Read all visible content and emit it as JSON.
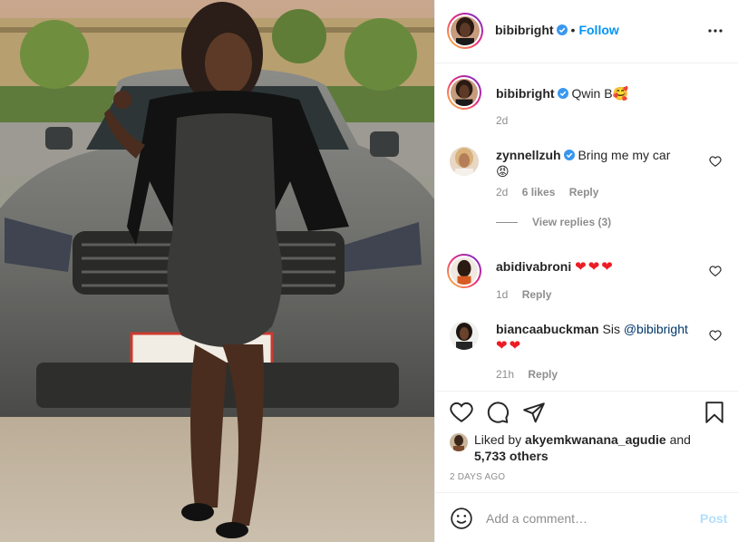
{
  "post": {
    "photo_alt": "image-photo",
    "author": "bibibright",
    "follow_label": "Follow",
    "caption": {
      "username": "bibibright",
      "text": "Qwin B",
      "emoji": "🥰",
      "time": "2d"
    }
  },
  "comments": [
    {
      "username": "zynnellzuh",
      "verified": true,
      "text": "Bring me my car",
      "emoji": "😡",
      "time": "2d",
      "likes": "6 likes",
      "reply_label": "Reply",
      "view_replies": "View replies (3)"
    },
    {
      "username": "abidivabroni",
      "verified": false,
      "hearts": "❤❤❤",
      "time": "1d",
      "reply_label": "Reply"
    },
    {
      "username": "biancaabuckman",
      "verified": false,
      "text": "Sis ",
      "mention": "@bibibright",
      "hearts": "❤❤",
      "time": "21h",
      "reply_label": "Reply"
    }
  ],
  "actions": {
    "liked_by_prefix": "Liked by ",
    "liked_by_user": "akyemkwanana_agudie",
    "liked_and": " and",
    "others": "5,733 others",
    "timeago": "2 DAYS AGO"
  },
  "composer": {
    "placeholder": "Add a comment…",
    "post_label": "Post"
  },
  "colors": {
    "accent": "#0095f6",
    "link": "#00376b",
    "muted": "#8e8e8e",
    "post_disabled": "#b2dffc",
    "heart_red": "#ed1c24"
  },
  "icons": [
    "more-icon",
    "verified-icon",
    "heart-icon",
    "comment-icon",
    "share-icon",
    "bookmark-icon",
    "emoji-icon"
  ]
}
